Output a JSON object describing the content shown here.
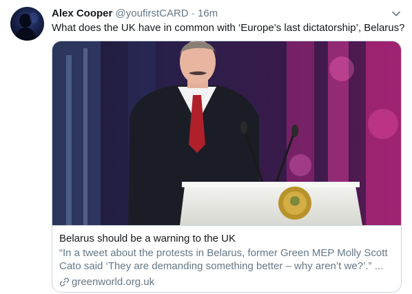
{
  "author": {
    "name": "Alex Cooper",
    "handle": "@youfirstCARD",
    "separator": "·",
    "time": "16m"
  },
  "tweet": {
    "text": "What does the UK have in common with ‘Europe’s last dictatorship’, Belarus?"
  },
  "card": {
    "title": "Belarus should be a warning to the UK",
    "description": "“In a tweet about the protests in Belarus, former Green MEP Molly Scott Cato said ‘They are demanding something better – why aren’t we?’.” ...",
    "domain": "greenworld.org.uk"
  },
  "icons": {
    "menu": "chevron-down-icon",
    "link": "link-icon"
  },
  "colors": {
    "text": "#14171a",
    "secondary": "#657786",
    "border": "#ccd6dd"
  }
}
